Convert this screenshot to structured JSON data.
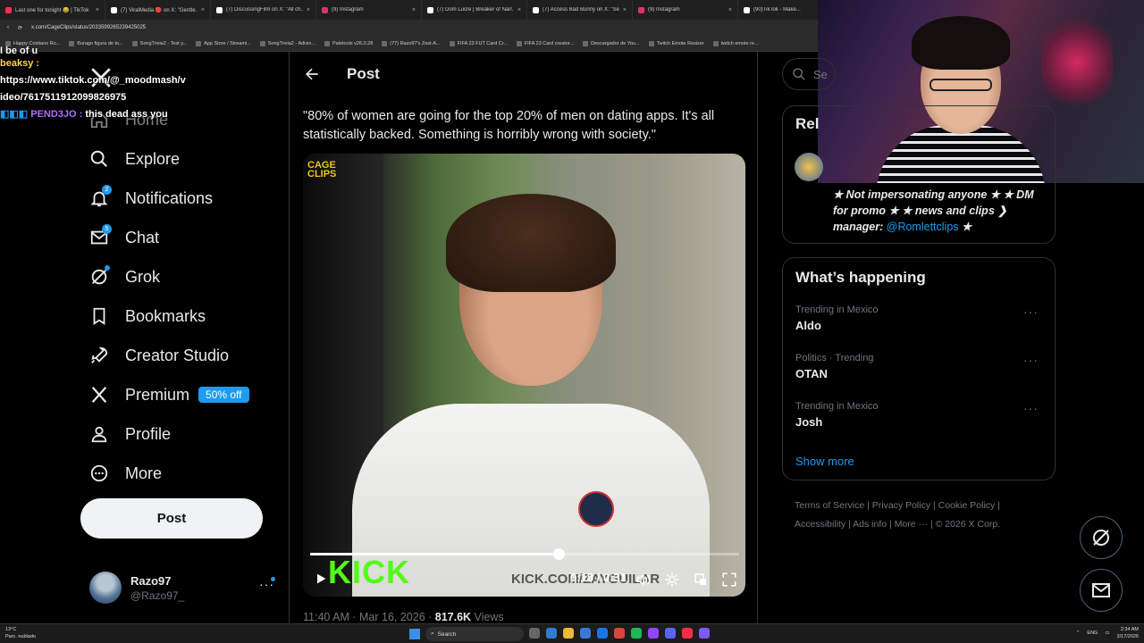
{
  "browser": {
    "tabs": [
      {
        "title": "Last one for tonight 😂 | TikTok",
        "color": "#ff2d55"
      },
      {
        "title": "(7) ViralMedia 🔴 on X: \"Gentle...",
        "color": "#ffffff"
      },
      {
        "title": "(7) DiscussingFilm on X: \"All ch...",
        "color": "#ffffff"
      },
      {
        "title": "(9) Instagram",
        "color": "#e1306c"
      },
      {
        "title": "(7) Dom Lucre | Breaker of Narr...",
        "color": "#ffffff"
      },
      {
        "title": "(7) Access Bad Bunny on X: \"Se...",
        "color": "#ffffff"
      },
      {
        "title": "(9) Instagram",
        "color": "#e1306c"
      },
      {
        "title": "(90)TikTok - Make...",
        "color": "#ffffff"
      }
    ],
    "url": "x.com/CageClips/status/2033599265239425025",
    "bookmarks": [
      "Happy Cristiano Ro...",
      "Burago figura de to...",
      "SongTrivia2 - Test y...",
      "App Store / Streami...",
      "SongTrivia2 - Adivin...",
      "Paletools v26.0.28",
      "(77) Razo97's Zest-A...",
      "FIFA 23 FUT Card Cr...",
      "FIFA 23 Card creator...",
      "Descargador de You...",
      "Twitch Emote Resizer",
      "twitch emote re..."
    ]
  },
  "chat": {
    "line1": "I be of u",
    "user1": "beaksy :",
    "msg1": "https://www.tiktok.com/@_moodmash/video/7617511912099826975",
    "user2": "PEND3JO :",
    "msg2": "this dead ass you"
  },
  "nav": {
    "items": [
      {
        "label": "Home",
        "icon": "home-icon"
      },
      {
        "label": "Explore",
        "icon": "search-icon"
      },
      {
        "label": "Notifications",
        "icon": "bell-icon",
        "badge": "2"
      },
      {
        "label": "Chat",
        "icon": "mail-icon",
        "badge": "5"
      },
      {
        "label": "Grok",
        "icon": "grok-icon"
      },
      {
        "label": "Bookmarks",
        "icon": "bookmark-icon"
      },
      {
        "label": "Creator Studio",
        "icon": "rocket-icon"
      },
      {
        "label": "Premium",
        "icon": "x-logo-icon",
        "pill": "50% off"
      },
      {
        "label": "Profile",
        "icon": "person-icon"
      },
      {
        "label": "More",
        "icon": "more-circle-icon"
      }
    ],
    "post_button": "Post",
    "account": {
      "name": "Razo97",
      "handle": "@Razo97_"
    }
  },
  "post": {
    "header": "Post",
    "text": "\"80% of women are going for the top 20% of men on dating apps. It's all statistically backed. Something is horribly wrong with society.\"",
    "video": {
      "watermark": "CAGE CLIPS",
      "kick_logo": "KICK",
      "kick_url": "KICK.COM/ZAYGUILAR",
      "time": "0:18 / 0:31",
      "progress": 0.58
    },
    "meta": {
      "time": "11:40 AM · Mar 16, 2026 · ",
      "views": "817.6K",
      "views_label": " Views"
    }
  },
  "right": {
    "search_placeholder": "Se",
    "relevant_title": "Rel",
    "bio": "★ Not impersonating anyone ★ ★ DM for promo ★ ★ news and clips ❯ manager:",
    "bio_link": "@Romlettclips",
    "bio_end": " ★",
    "happening_title": "What’s happening",
    "trends": [
      {
        "context": "Trending in Mexico",
        "name": "Aldo"
      },
      {
        "context": "Politics · Trending",
        "name": "OTAN"
      },
      {
        "context": "Trending in Mexico",
        "name": "Josh"
      }
    ],
    "show_more": "Show more",
    "footer": [
      "Terms of Service",
      "Privacy Policy",
      "Cookie Policy",
      "Accessibility",
      "Ads info",
      "More ···",
      "© 2026 X Corp."
    ]
  },
  "taskbar": {
    "weather_temp": "13°C",
    "weather_desc": "Parc. nublado",
    "search": "Search",
    "lang": "ENG",
    "time": "2:34 AM",
    "date": "3/17/2026"
  },
  "colors": {
    "accent": "#1d9bf0",
    "kick": "#53fc18",
    "bg": "#000000"
  }
}
